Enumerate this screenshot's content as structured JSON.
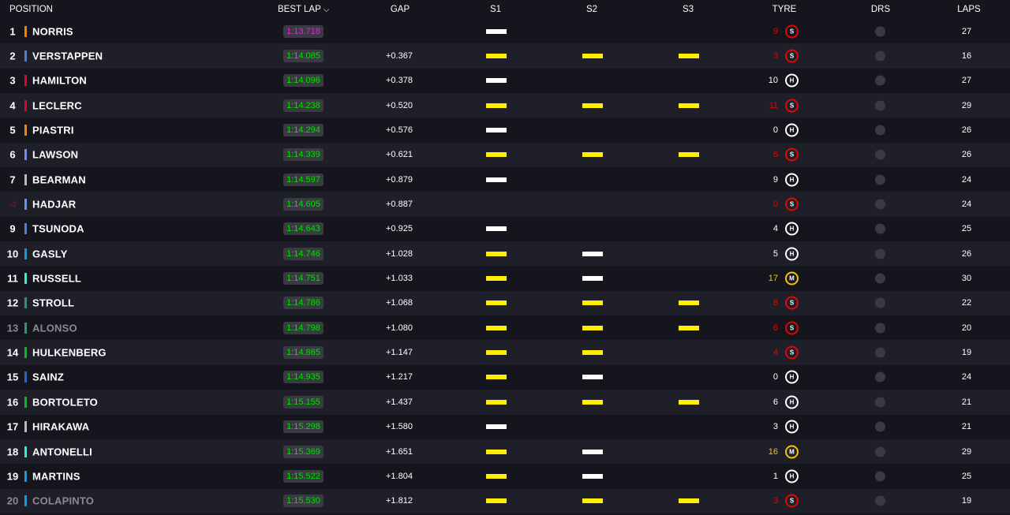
{
  "header": {
    "position": "POSITION",
    "best_lap": "BEST LAP",
    "gap": "GAP",
    "s1": "S1",
    "s2": "S2",
    "s3": "S3",
    "tyre": "TYRE",
    "drs": "DRS",
    "laps": "LAPS",
    "sort_icon": "chevron-down-icon"
  },
  "colors": {
    "background": "#15151e",
    "row_alt": "#1f1f29",
    "personal_best": "#00e000",
    "overall_best": "#d12fd1",
    "sector_yellow": "#ffee00",
    "sector_white": "#ffffff",
    "soft": "#e10600",
    "medium": "#f5c400",
    "hard": "#ffffff"
  },
  "rows": [
    {
      "pos": "1",
      "name": "NORRIS",
      "team_color": "#ff8000",
      "best_lap": "1:13.718",
      "lap_color": "#d12fd1",
      "gap": "",
      "s1": "white",
      "s2": "",
      "s3": "",
      "tyre_laps": "9",
      "tyre": "S",
      "laps": "27",
      "dim": false
    },
    {
      "pos": "2",
      "name": "VERSTAPPEN",
      "team_color": "#4781d7",
      "best_lap": "1:14.085",
      "lap_color": "#00e000",
      "gap": "+0.367",
      "s1": "yellow",
      "s2": "yellow",
      "s3": "yellow",
      "tyre_laps": "3",
      "tyre": "S",
      "laps": "16",
      "dim": false
    },
    {
      "pos": "3",
      "name": "HAMILTON",
      "team_color": "#e8002d",
      "best_lap": "1:14.096",
      "lap_color": "#00e000",
      "gap": "+0.378",
      "s1": "white",
      "s2": "",
      "s3": "",
      "tyre_laps": "10",
      "tyre": "H",
      "laps": "27",
      "dim": false
    },
    {
      "pos": "4",
      "name": "LECLERC",
      "team_color": "#e8002d",
      "best_lap": "1:14.238",
      "lap_color": "#00e000",
      "gap": "+0.520",
      "s1": "yellow",
      "s2": "yellow",
      "s3": "yellow",
      "tyre_laps": "11",
      "tyre": "S",
      "laps": "29",
      "dim": false
    },
    {
      "pos": "5",
      "name": "PIASTRI",
      "team_color": "#ff8000",
      "best_lap": "1:14.294",
      "lap_color": "#00e000",
      "gap": "+0.576",
      "s1": "white",
      "s2": "",
      "s3": "",
      "tyre_laps": "0",
      "tyre": "H",
      "laps": "26",
      "dim": false
    },
    {
      "pos": "6",
      "name": "LAWSON",
      "team_color": "#6692ff",
      "best_lap": "1:14.339",
      "lap_color": "#00e000",
      "gap": "+0.621",
      "s1": "yellow",
      "s2": "yellow",
      "s3": "yellow",
      "tyre_laps": "6",
      "tyre": "S",
      "laps": "26",
      "dim": false
    },
    {
      "pos": "7",
      "name": "BEARMAN",
      "team_color": "#b6babd",
      "best_lap": "1:14.597",
      "lap_color": "#00e000",
      "gap": "+0.879",
      "s1": "white",
      "s2": "",
      "s3": "",
      "tyre_laps": "9",
      "tyre": "H",
      "laps": "24",
      "dim": false
    },
    {
      "pos": "◁",
      "name": "HADJAR",
      "team_color": "#6692ff",
      "best_lap": "1:14.605",
      "lap_color": "#00e000",
      "gap": "+0.887",
      "s1": "",
      "s2": "",
      "s3": "",
      "tyre_laps": "0",
      "tyre": "S",
      "laps": "24",
      "dim": false,
      "arrow": true
    },
    {
      "pos": "9",
      "name": "TSUNODA",
      "team_color": "#4781d7",
      "best_lap": "1:14.643",
      "lap_color": "#00e000",
      "gap": "+0.925",
      "s1": "white",
      "s2": "",
      "s3": "",
      "tyre_laps": "4",
      "tyre": "H",
      "laps": "25",
      "dim": false
    },
    {
      "pos": "10",
      "name": "GASLY",
      "team_color": "#00a1e8",
      "best_lap": "1:14.746",
      "lap_color": "#00e000",
      "gap": "+1.028",
      "s1": "yellow",
      "s2": "white",
      "s3": "",
      "tyre_laps": "5",
      "tyre": "H",
      "laps": "26",
      "dim": false
    },
    {
      "pos": "11",
      "name": "RUSSELL",
      "team_color": "#27f4d2",
      "best_lap": "1:14.751",
      "lap_color": "#00e000",
      "gap": "+1.033",
      "s1": "yellow",
      "s2": "white",
      "s3": "",
      "tyre_laps": "17",
      "tyre": "M",
      "laps": "30",
      "dim": false
    },
    {
      "pos": "12",
      "name": "STROLL",
      "team_color": "#229971",
      "best_lap": "1:14.786",
      "lap_color": "#00e000",
      "gap": "+1.068",
      "s1": "yellow",
      "s2": "yellow",
      "s3": "yellow",
      "tyre_laps": "8",
      "tyre": "S",
      "laps": "22",
      "dim": false
    },
    {
      "pos": "13",
      "name": "ALONSO",
      "team_color": "#229971",
      "best_lap": "1:14.798",
      "lap_color": "#00e000",
      "gap": "+1.080",
      "s1": "yellow",
      "s2": "yellow",
      "s3": "yellow",
      "tyre_laps": "6",
      "tyre": "S",
      "laps": "20",
      "dim": true
    },
    {
      "pos": "14",
      "name": "HULKENBERG",
      "team_color": "#01c00e",
      "best_lap": "1:14.865",
      "lap_color": "#00e000",
      "gap": "+1.147",
      "s1": "yellow",
      "s2": "yellow",
      "s3": "",
      "tyre_laps": "4",
      "tyre": "S",
      "laps": "19",
      "dim": false
    },
    {
      "pos": "15",
      "name": "SAINZ",
      "team_color": "#1868db",
      "best_lap": "1:14.935",
      "lap_color": "#00e000",
      "gap": "+1.217",
      "s1": "yellow",
      "s2": "white",
      "s3": "",
      "tyre_laps": "0",
      "tyre": "H",
      "laps": "24",
      "dim": false
    },
    {
      "pos": "16",
      "name": "BORTOLETO",
      "team_color": "#01c00e",
      "best_lap": "1:15.155",
      "lap_color": "#00e000",
      "gap": "+1.437",
      "s1": "yellow",
      "s2": "yellow",
      "s3": "yellow",
      "tyre_laps": "6",
      "tyre": "H",
      "laps": "21",
      "dim": false
    },
    {
      "pos": "17",
      "name": "HIRAKAWA",
      "team_color": "#b6babd",
      "best_lap": "1:15.298",
      "lap_color": "#00e000",
      "gap": "+1.580",
      "s1": "white",
      "s2": "",
      "s3": "",
      "tyre_laps": "3",
      "tyre": "H",
      "laps": "21",
      "dim": false
    },
    {
      "pos": "18",
      "name": "ANTONELLI",
      "team_color": "#27f4d2",
      "best_lap": "1:15.369",
      "lap_color": "#00e000",
      "gap": "+1.651",
      "s1": "yellow",
      "s2": "white",
      "s3": "",
      "tyre_laps": "16",
      "tyre": "M",
      "laps": "29",
      "dim": false
    },
    {
      "pos": "19",
      "name": "MARTINS",
      "team_color": "#00a1e8",
      "best_lap": "1:15.522",
      "lap_color": "#00e000",
      "gap": "+1.804",
      "s1": "yellow",
      "s2": "white",
      "s3": "",
      "tyre_laps": "1",
      "tyre": "H",
      "laps": "25",
      "dim": false
    },
    {
      "pos": "20",
      "name": "COLAPINTO",
      "team_color": "#00a1e8",
      "best_lap": "1:15.530",
      "lap_color": "#00e000",
      "gap": "+1.812",
      "s1": "yellow",
      "s2": "yellow",
      "s3": "yellow",
      "tyre_laps": "3",
      "tyre": "S",
      "laps": "19",
      "dim": true
    }
  ]
}
